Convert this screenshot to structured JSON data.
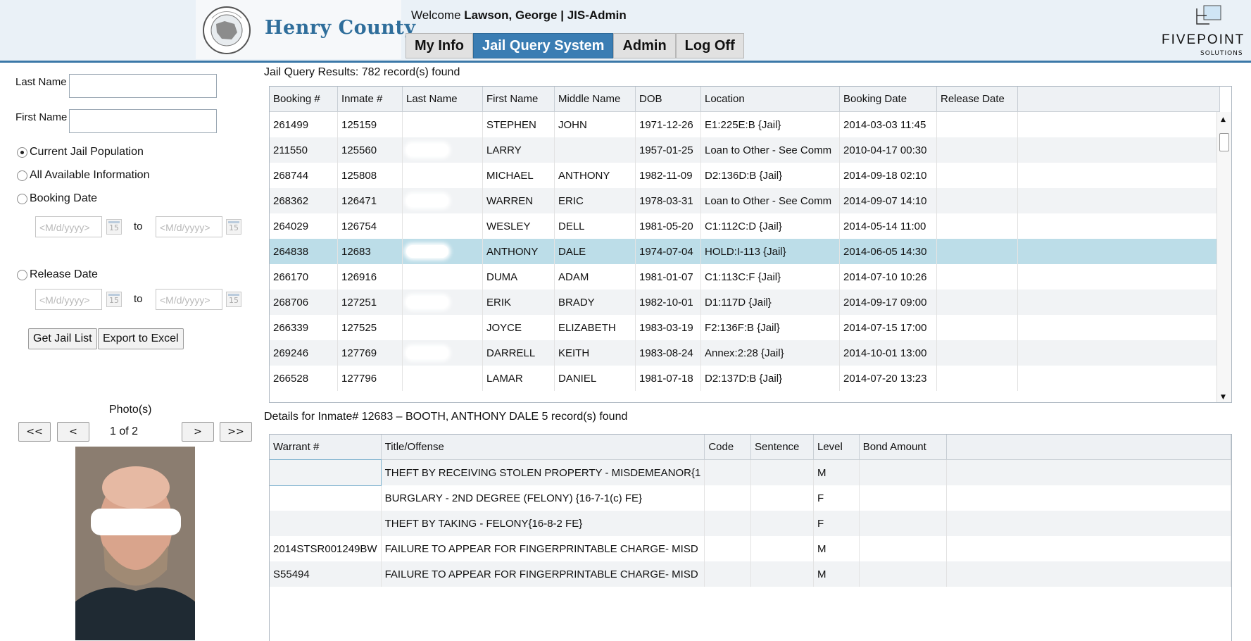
{
  "header": {
    "county_name": "Henry County",
    "seal_text_top": "HENRY COUNTY",
    "seal_text_right": "GA",
    "seal_year": "1821",
    "welcome_prefix": "Welcome ",
    "welcome_user": "Lawson, George | JIS-Admin",
    "tabs": [
      {
        "label": "My Info",
        "active": false
      },
      {
        "label": "Jail Query System",
        "active": true
      },
      {
        "label": "Admin",
        "active": false
      },
      {
        "label": "Log Off",
        "active": false
      }
    ],
    "vendor_name": "FIVEPOINT",
    "vendor_sub": "SOLUTIONS",
    "accent_color": "#3a7db3"
  },
  "search": {
    "last_name_label": "Last Name",
    "last_name_value": "",
    "first_name_label": "First Name",
    "first_name_value": "",
    "options": [
      {
        "label": "Current Jail Population",
        "selected": true
      },
      {
        "label": "All Available Information",
        "selected": false
      },
      {
        "label": "Booking Date",
        "selected": false
      },
      {
        "label": "Release Date",
        "selected": false
      }
    ],
    "date_placeholder": "<M/d/yyyy>",
    "calendar_icon_text": "15",
    "to_label": "to",
    "get_list_label": "Get Jail List",
    "export_label": "Export to Excel"
  },
  "photo": {
    "title": "Photo(s)",
    "first_label": "<<",
    "prev_label": "<",
    "next_label": ">",
    "last_label": ">>",
    "counter": "1 of 2"
  },
  "results": {
    "caption": "Jail Query Results:  782 record(s) found",
    "columns": [
      "Booking #",
      "Inmate #",
      "Last Name",
      "First Name",
      "Middle Name",
      "DOB",
      "Location",
      "Booking Date",
      "Release Date"
    ],
    "rows": [
      [
        "261499",
        "125159",
        "",
        "STEPHEN",
        "JOHN",
        "1971-12-26",
        "E1:225E:B {Jail}",
        "2014-03-03 11:45",
        ""
      ],
      [
        "211550",
        "125560",
        "",
        "LARRY",
        "",
        "1957-01-25",
        "Loan to Other - See Comm",
        "2010-04-17 00:30",
        ""
      ],
      [
        "268744",
        "125808",
        "",
        "MICHAEL",
        "ANTHONY",
        "1982-11-09",
        "D2:136D:B {Jail}",
        "2014-09-18 02:10",
        ""
      ],
      [
        "268362",
        "126471",
        "",
        "WARREN",
        "ERIC",
        "1978-03-31",
        "Loan to Other - See Comm",
        "2014-09-07 14:10",
        ""
      ],
      [
        "264029",
        "126754",
        "",
        "WESLEY",
        "DELL",
        "1981-05-20",
        "C1:112C:D {Jail}",
        "2014-05-14 11:00",
        ""
      ],
      [
        "264838",
        "12683",
        "",
        "ANTHONY",
        "DALE",
        "1974-07-04",
        "HOLD:I-113 {Jail}",
        "2014-06-05 14:30",
        ""
      ],
      [
        "266170",
        "126916",
        "",
        "DUMA",
        "ADAM",
        "1981-01-07",
        "C1:113C:F {Jail}",
        "2014-07-10 10:26",
        ""
      ],
      [
        "268706",
        "127251",
        "",
        "ERIK",
        "BRADY",
        "1982-10-01",
        "D1:117D {Jail}",
        "2014-09-17 09:00",
        ""
      ],
      [
        "266339",
        "127525",
        "",
        "JOYCE",
        "ELIZABETH",
        "1983-03-19",
        "F2:136F:B {Jail}",
        "2014-07-15 17:00",
        ""
      ],
      [
        "269246",
        "127769",
        "",
        "DARRELL",
        "KEITH",
        "1983-08-24",
        "Annex:2:28 {Jail}",
        "2014-10-01 13:00",
        ""
      ],
      [
        "266528",
        "127796",
        "",
        "LAMAR",
        "DANIEL",
        "1981-07-18",
        "D2:137D:B {Jail}",
        "2014-07-20 13:23",
        ""
      ]
    ],
    "selected_row": 5
  },
  "details": {
    "caption": "Details for Inmate# 12683 – BOOTH, ANTHONY DALE 5 record(s) found",
    "columns": [
      "Warrant #",
      "Title/Offense",
      "Code",
      "Sentence",
      "Level",
      "Bond Amount"
    ],
    "rows": [
      [
        "",
        "THEFT BY RECEIVING STOLEN PROPERTY - MISDEMEANOR{1",
        "",
        "",
        "M",
        ""
      ],
      [
        "",
        "BURGLARY - 2ND DEGREE (FELONY) {16-7-1(c) FE}",
        "",
        "",
        "F",
        ""
      ],
      [
        "",
        "THEFT BY TAKING - FELONY{16-8-2 FE}",
        "",
        "",
        "F",
        ""
      ],
      [
        "2014STSR001249BW",
        "FAILURE TO APPEAR FOR FINGERPRINTABLE CHARGE- MISD",
        "",
        "",
        "M",
        ""
      ],
      [
        "S55494",
        "FAILURE TO APPEAR FOR FINGERPRINTABLE CHARGE- MISD",
        "",
        "",
        "M",
        ""
      ]
    ]
  }
}
